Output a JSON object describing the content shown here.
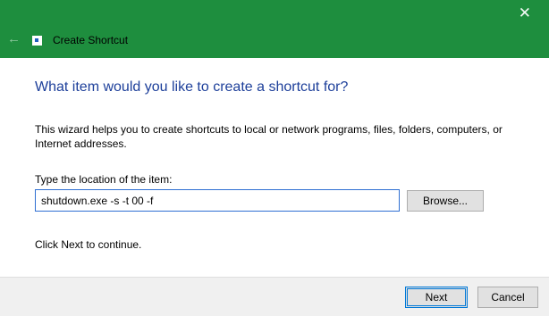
{
  "window": {
    "title": "Create Shortcut",
    "close_glyph": "✕",
    "back_glyph": "←"
  },
  "wizard": {
    "heading": "What item would you like to create a shortcut for?",
    "description": "This wizard helps you to create shortcuts to local or network programs, files, folders, computers, or Internet addresses.",
    "field_label": "Type the location of the item:",
    "location_value": "shutdown.exe -s -t 00 -f",
    "browse_label": "Browse...",
    "hint": "Click Next to continue."
  },
  "footer": {
    "next_label": "Next",
    "cancel_label": "Cancel"
  },
  "colors": {
    "titlebar": "#1e8e3e",
    "heading": "#1d3f9a",
    "focus": "#0078d7"
  },
  "icons": {
    "back": "back-arrow-icon",
    "app": "shortcut-app-icon",
    "close": "close-icon"
  }
}
